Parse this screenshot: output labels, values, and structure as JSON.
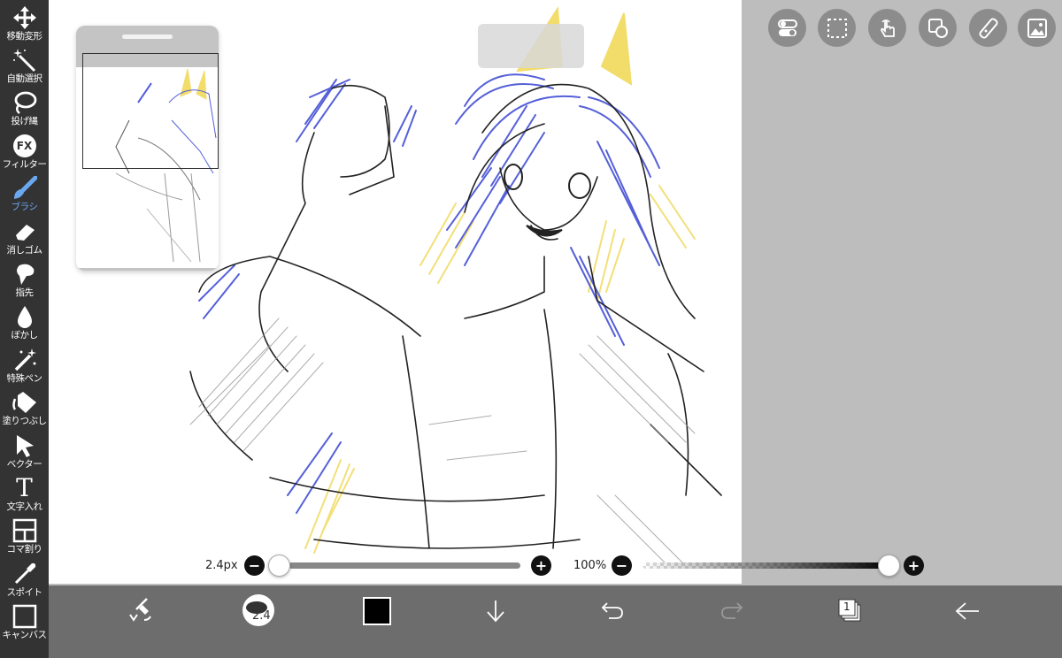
{
  "toolbar": {
    "tools": [
      {
        "label": "移動変形",
        "icon": "move-arrows-icon"
      },
      {
        "label": "自動選択",
        "icon": "magic-wand-icon"
      },
      {
        "label": "投げ縄",
        "icon": "lasso-icon"
      },
      {
        "label": "フィルター",
        "icon": "fx-icon",
        "icon_text": "FX"
      },
      {
        "label": "ブラシ",
        "icon": "brush-icon",
        "active": true
      },
      {
        "label": "消しゴム",
        "icon": "eraser-icon"
      },
      {
        "label": "指先",
        "icon": "smudge-icon"
      },
      {
        "label": "ぼかし",
        "icon": "blur-drop-icon"
      },
      {
        "label": "特殊ペン",
        "icon": "special-pen-icon"
      },
      {
        "label": "塗りつぶし",
        "icon": "fill-bucket-icon"
      },
      {
        "label": "ベクター",
        "icon": "vector-cursor-icon"
      },
      {
        "label": "文字入れ",
        "icon": "text-icon",
        "icon_text": "T"
      },
      {
        "label": "コマ割り",
        "icon": "frame-divider-icon"
      },
      {
        "label": "スポイト",
        "icon": "eyedropper-icon"
      },
      {
        "label": "キャンバス",
        "icon": "canvas-icon"
      }
    ]
  },
  "top_actions": [
    "toggle-icon",
    "selection-icon",
    "touch-icon",
    "shape-icon",
    "ruler-icon",
    "image-icon"
  ],
  "brush_size": {
    "label": "2.4px",
    "value": 2.4
  },
  "opacity": {
    "label": "100%",
    "value": 100
  },
  "bottombar": {
    "brush_preview_text": "2.4",
    "color": "#000000",
    "layer_count": "1"
  },
  "colors": {
    "toolbar_bg": "#333333",
    "active": "#6aa8f0",
    "blue_ink": "#5560d8",
    "yellow_ink": "#f2dc6a"
  }
}
